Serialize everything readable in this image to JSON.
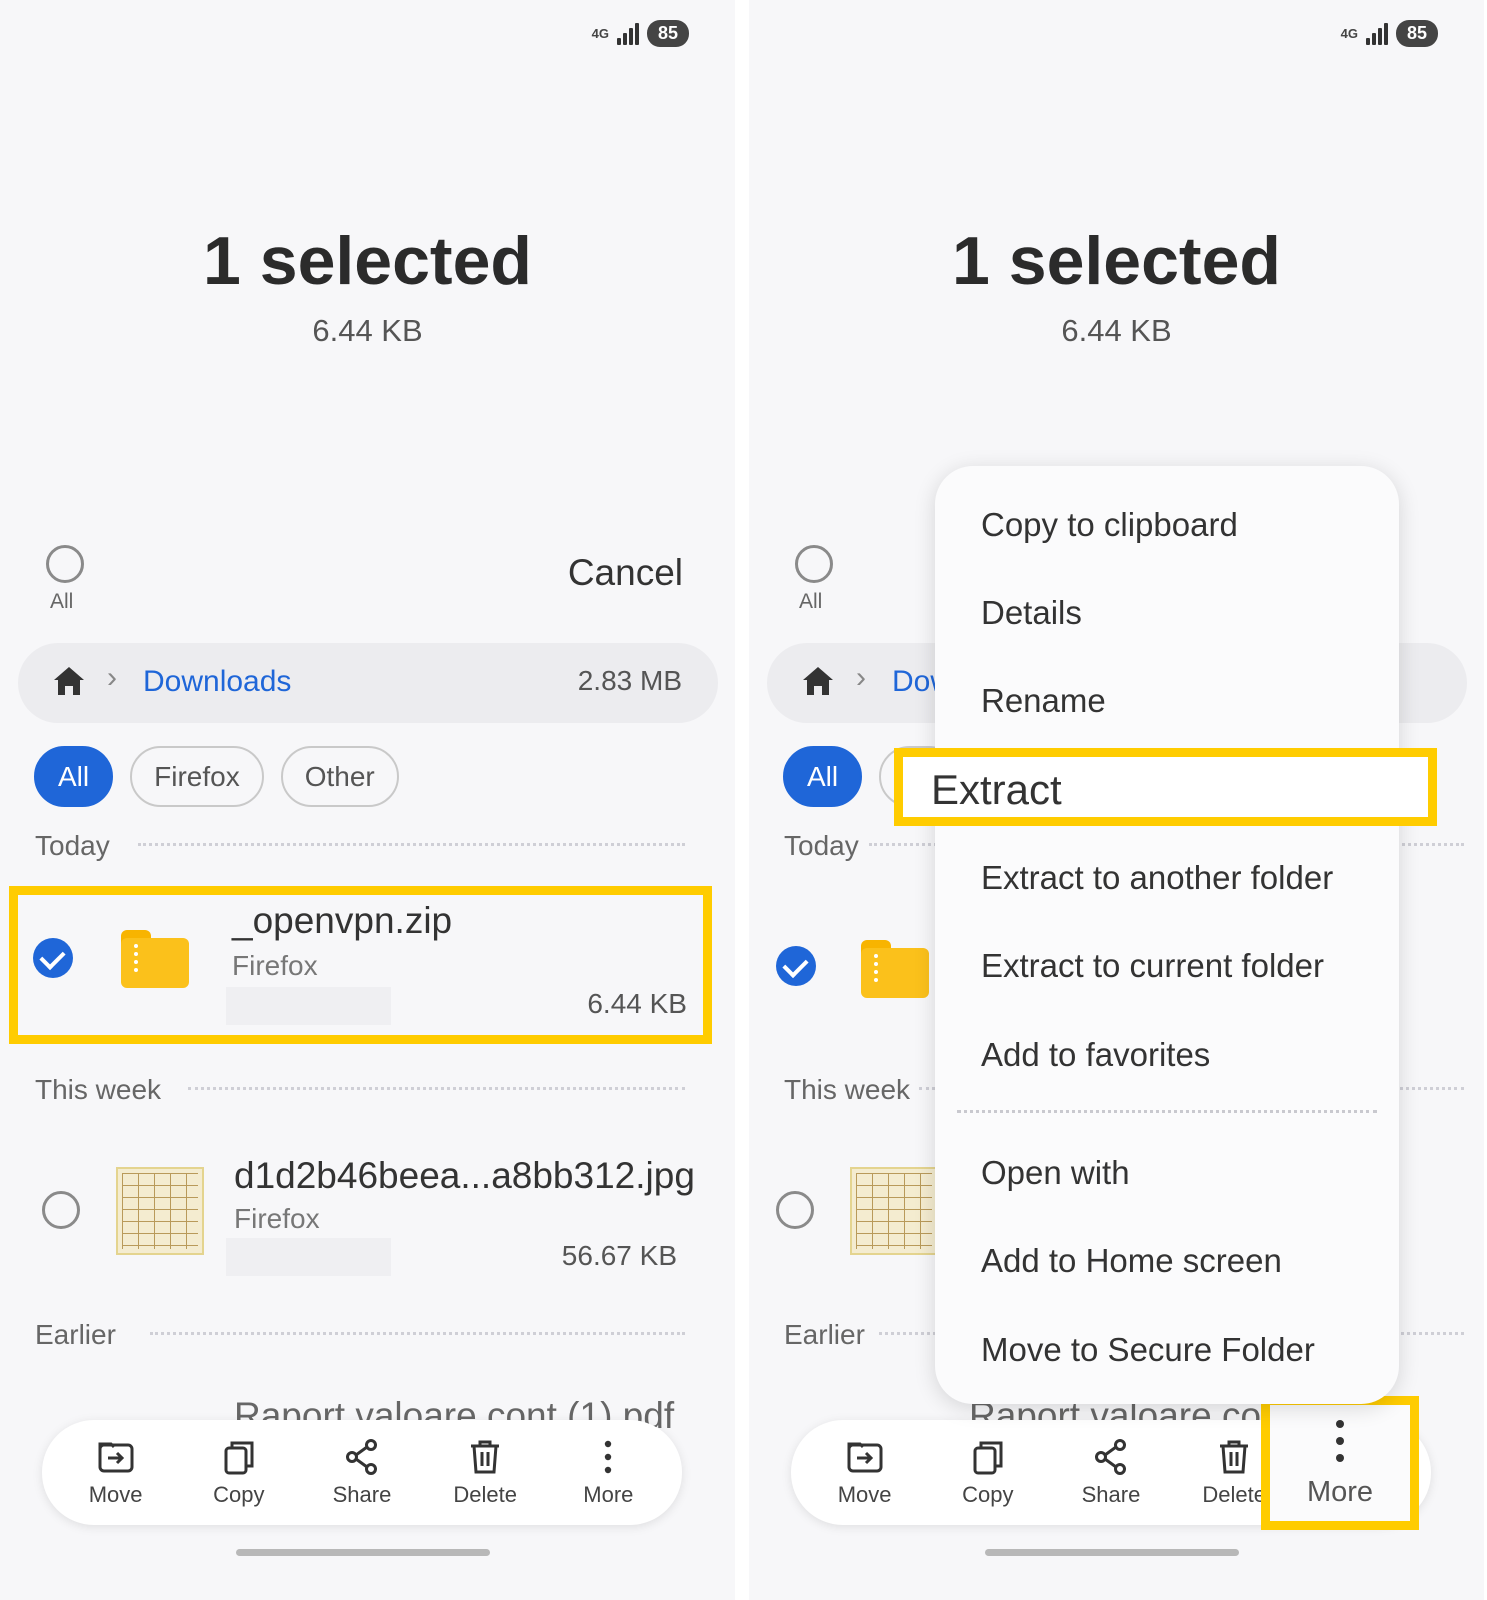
{
  "status": {
    "network": "4G",
    "battery": "85"
  },
  "header": {
    "title": "1 selected",
    "size": "6.44 KB"
  },
  "select_all": {
    "label": "All"
  },
  "cancel_label": "Cancel",
  "breadcrumb": {
    "folder": "Downloads",
    "folder_partial": "Dow",
    "size": "2.83 MB"
  },
  "filters": [
    "All",
    "Firefox",
    "Other"
  ],
  "sections": {
    "today": "Today",
    "this_week": "This week",
    "earlier": "Earlier"
  },
  "files": [
    {
      "name": "_openvpn.zip",
      "source": "Firefox",
      "size": "6.44 KB",
      "selected": true
    },
    {
      "name": "d1d2b46beea...a8bb312.jpg",
      "source": "Firefox",
      "size": "56.67 KB",
      "selected": false
    },
    {
      "name": "Raport valoare cont (1).pdf",
      "name_partial": "Raport valoare con"
    }
  ],
  "toolbar": {
    "move": "Move",
    "copy": "Copy",
    "share": "Share",
    "delete": "Delete",
    "more": "More"
  },
  "menu": {
    "copy_to_clipboard": "Copy to clipboard",
    "details": "Details",
    "rename": "Rename",
    "extract": "Extract",
    "extract_another": "Extract to another folder",
    "extract_current": "Extract to current folder",
    "add_favorites": "Add to favorites",
    "open_with": "Open with",
    "add_home": "Add to Home screen",
    "move_secure": "Move to Secure Folder"
  },
  "colors": {
    "accent": "#1f66d8",
    "highlight": "#ffcc00",
    "folder": "#fbc11b"
  }
}
